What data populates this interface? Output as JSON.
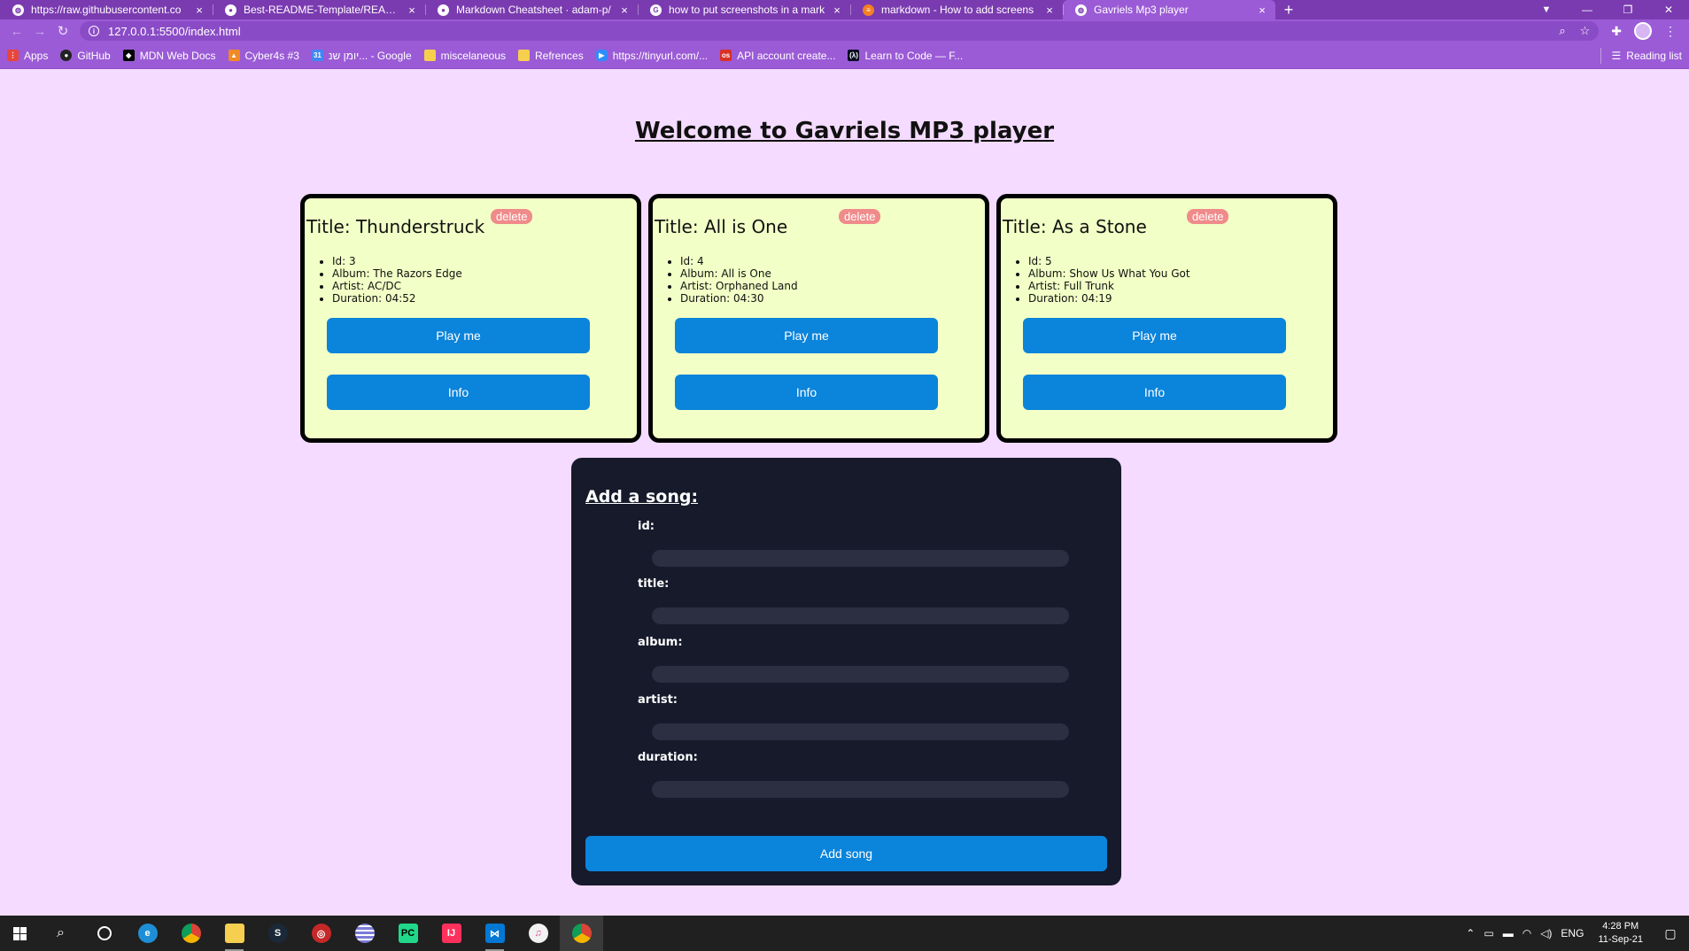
{
  "browser": {
    "tabs": [
      {
        "title": "https://raw.githubusercontent.co",
        "icon": "globe-icon",
        "active": false
      },
      {
        "title": "Best-README-Template/READMI",
        "icon": "github-icon",
        "active": false
      },
      {
        "title": "Markdown Cheatsheet · adam-p/",
        "icon": "github-icon",
        "active": false
      },
      {
        "title": "how to put screenshots in a mark",
        "icon": "google-icon",
        "active": false
      },
      {
        "title": "markdown - How to add screens",
        "icon": "stackoverflow-icon",
        "active": false
      },
      {
        "title": "Gavriels Mp3 player",
        "icon": "globe-icon",
        "active": true
      }
    ],
    "new_tab": "+",
    "close_glyph": "×",
    "url": "127.0.0.1:5500/index.html",
    "bookmarks": [
      {
        "label": "Apps",
        "icon": "apps-grid-icon",
        "color": "#e8453c"
      },
      {
        "label": "GitHub",
        "icon": "github-icon",
        "color": "#222222"
      },
      {
        "label": "MDN Web Docs",
        "icon": "mdn-icon",
        "color": "#000000"
      },
      {
        "label": "Cyber4s #3",
        "icon": "cyber4s-icon",
        "color": "#f08a24"
      },
      {
        "label": "יומן שנ... - Google",
        "icon": "calendar-icon",
        "color": "#4285f4"
      },
      {
        "label": "miscelaneous",
        "icon": "folder-icon",
        "color": "#f7cf4f"
      },
      {
        "label": "Refrences",
        "icon": "folder-icon",
        "color": "#f7cf4f"
      },
      {
        "label": "https://tinyurl.com/...",
        "icon": "zoom-icon",
        "color": "#2d8cff"
      },
      {
        "label": "API account create...",
        "icon": "os-icon",
        "color": "#d93025"
      },
      {
        "label": "Learn to Code — F...",
        "icon": "fcc-icon",
        "color": "#0a0a23"
      }
    ],
    "reading_list": "Reading list"
  },
  "page": {
    "heading": "Welcome to Gavriels MP3 player",
    "songs": [
      {
        "title": "Title: Thunderstruck",
        "delete": "delete",
        "details": [
          "Id: 3",
          "Album: The Razors Edge",
          "Artist: AC/DC",
          "Duration: 04:52"
        ],
        "play": "Play me",
        "info": "Info"
      },
      {
        "title": "Title: All is One",
        "delete": "delete",
        "details": [
          "Id: 4",
          "Album: All is One",
          "Artist: Orphaned Land",
          "Duration: 04:30"
        ],
        "play": "Play me",
        "info": "Info"
      },
      {
        "title": "Title: As a Stone",
        "delete": "delete",
        "details": [
          "Id: 5",
          "Album: Show Us What You Got",
          "Artist: Full Trunk",
          "Duration: 04:19"
        ],
        "play": "Play me",
        "info": "Info"
      }
    ],
    "form": {
      "heading": "Add a song:",
      "fields": [
        {
          "label": "id:",
          "value": ""
        },
        {
          "label": "title:",
          "value": ""
        },
        {
          "label": "album:",
          "value": ""
        },
        {
          "label": "artist:",
          "value": ""
        },
        {
          "label": "duration:",
          "value": ""
        }
      ],
      "submit": "Add song"
    }
  },
  "taskbar": {
    "apps": [
      "start",
      "search",
      "cortana",
      "edge",
      "chrome",
      "file-explorer",
      "steam",
      "app-red",
      "app-striped",
      "pycharm",
      "intellij",
      "vscode",
      "itunes",
      "chrome-profile"
    ],
    "language": "ENG",
    "time": "4:28 PM",
    "date": "11-Sep-21"
  },
  "colors": {
    "tabbar": "#7a3bb0",
    "toolbar": "#9b5bd6",
    "page_bg": "#f4dbff",
    "card_bg": "#f2ffc6",
    "button": "#0b84db",
    "delete": "#f08b8b",
    "form_bg": "#161a2b"
  }
}
